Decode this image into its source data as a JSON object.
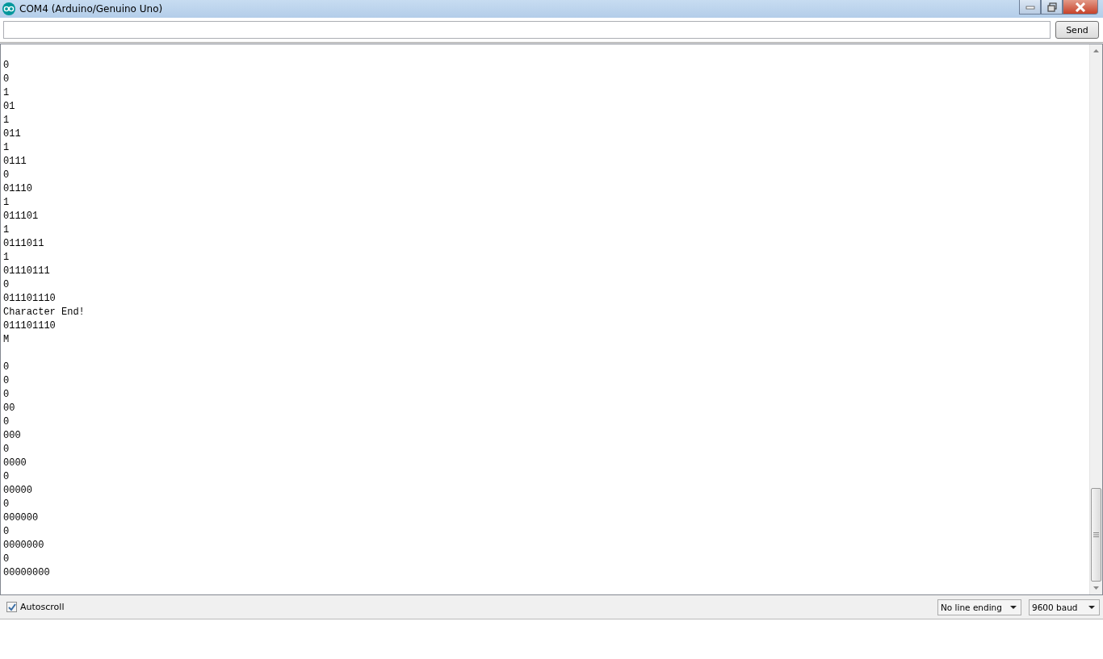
{
  "window": {
    "title": "COM4 (Arduino/Genuino Uno)"
  },
  "send_button": "Send",
  "output_blocks": [
    {
      "lines": [
        "0",
        "0",
        "1",
        "01",
        "1",
        "011",
        "1",
        "0111",
        "0",
        "01110",
        "1",
        "011101",
        "1",
        "0111011",
        "1",
        "01110111",
        "0",
        "011101110",
        "Character End!",
        "011101110",
        "M"
      ]
    },
    {
      "lines": [
        "0",
        "0",
        "0",
        "00",
        "0",
        "000",
        "0",
        "0000",
        "0",
        "00000",
        "0",
        "000000",
        "0",
        "0000000",
        "0",
        "00000000"
      ]
    }
  ],
  "autoscroll": {
    "label": "Autoscroll",
    "checked": true
  },
  "line_ending": "No line ending",
  "baud": "9600 baud"
}
